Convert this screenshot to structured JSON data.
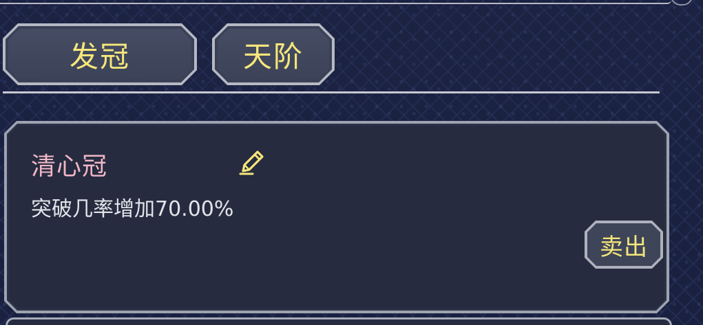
{
  "tabs": [
    {
      "label": "发冠"
    },
    {
      "label": "天阶"
    }
  ],
  "item": {
    "name": "清心冠",
    "description": "突破几率增加70.00%",
    "sell_label": "卖出",
    "edit_icon": "pencil-icon"
  },
  "colors": {
    "accent_yellow": "#f6e67a",
    "item_name_pink": "#f0b7c6",
    "panel_bg": "#262b3f",
    "border_silver": "#b6b9c3"
  }
}
